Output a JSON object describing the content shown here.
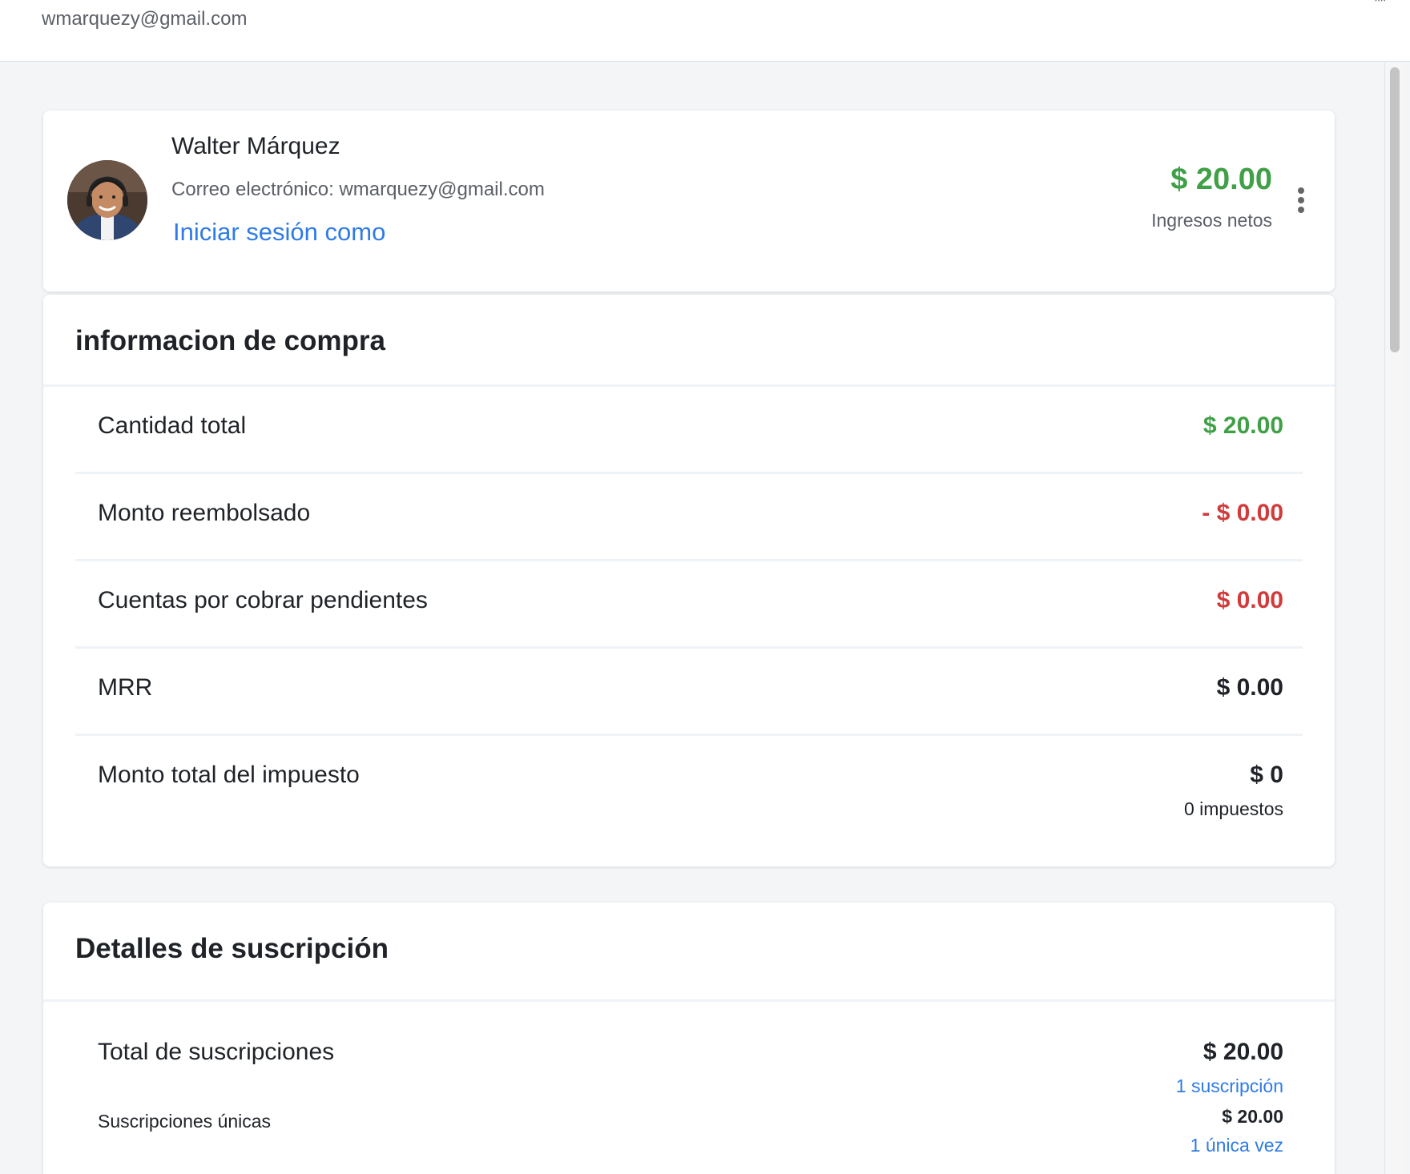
{
  "topbar": {
    "email": "wmarquezy@gmail.com",
    "corner_glyph": "\"\""
  },
  "profile": {
    "name": "Walter Márquez",
    "email_line": "Correo electrónico: wmarquezy@gmail.com",
    "login_as": "Iniciar sesión como",
    "net_amount": "$ 20.00",
    "net_label": "Ingresos netos",
    "menu_icon": "kebab-vertical-icon"
  },
  "purchase": {
    "title": "informacion de compra",
    "rows": [
      {
        "label": "Cantidad total",
        "value": "$ 20.00",
        "color": "#3fa047"
      },
      {
        "label": "Monto reembolsado",
        "value": "- $ 0.00",
        "color": "#d13b3b"
      },
      {
        "label": "Cuentas por cobrar pendientes",
        "value": "$ 0.00",
        "color": "#d13b3b"
      },
      {
        "label": "MRR",
        "value": "$ 0.00",
        "color": "#1f2328"
      },
      {
        "label": "Monto total del impuesto",
        "value": "$ 0",
        "sub": "0 impuestos",
        "color": "#1f2328"
      }
    ]
  },
  "subscription": {
    "title": "Detalles de suscripción",
    "total_label": "Total de suscripciones",
    "total_value": "$ 20.00",
    "total_link": "1 suscripción",
    "unique_label": "Suscripciones únicas",
    "unique_value": "$ 20.00",
    "unique_link": "1 única vez"
  },
  "colors": {
    "accent_blue": "#2f7be5",
    "positive_green": "#3fa047",
    "negative_red": "#d13b3b"
  }
}
